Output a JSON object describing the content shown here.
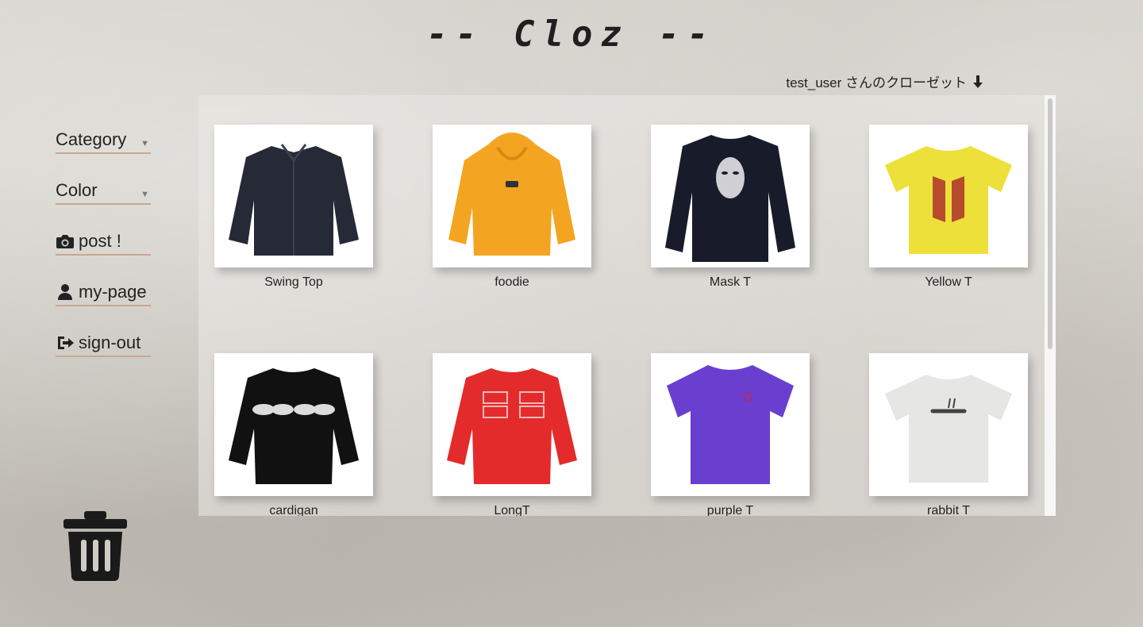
{
  "app": {
    "title": "-- Cloz --"
  },
  "closet": {
    "label": "test_user さんのクローゼット"
  },
  "nav": {
    "category": "Category",
    "color": "Color",
    "post": "post !",
    "mypage": "my-page",
    "signout": "sign-out"
  },
  "items": [
    {
      "name": "Swing Top",
      "color": "#262a36",
      "icon": "jacket-icon"
    },
    {
      "name": "foodie",
      "color": "#f3a522",
      "icon": "hoodie-icon"
    },
    {
      "name": "Mask T",
      "color": "#181c2a",
      "icon": "longsleeve-icon"
    },
    {
      "name": "Yellow T",
      "color": "#ede03a",
      "icon": "tshirt-icon"
    },
    {
      "name": "cardigan",
      "color": "#111111",
      "icon": "sweater-icon"
    },
    {
      "name": "LongT",
      "color": "#e32b2b",
      "icon": "sweater-icon"
    },
    {
      "name": "purple T",
      "color": "#6a3fd0",
      "icon": "tshirt-icon"
    },
    {
      "name": "rabbit T",
      "color": "#e6e6e4",
      "icon": "tshirt-icon"
    }
  ]
}
